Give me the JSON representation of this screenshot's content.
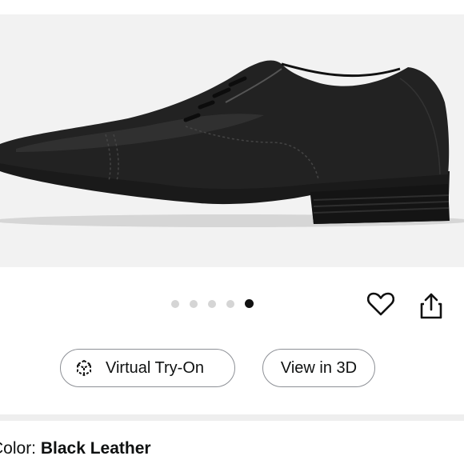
{
  "product_image": {
    "alt": "Black leather cap-toe oxford dress shoe",
    "carousel_count": 5,
    "active_index": 4
  },
  "actions": {
    "favorite_icon": "heart-outline-icon",
    "share_icon": "share-icon"
  },
  "buttons": {
    "virtual_try_on_label": "Virtual Try-On",
    "virtual_try_on_icon": "ar-cube-icon",
    "view_3d_label": "View in 3D"
  },
  "color": {
    "label": "Color: ",
    "value": "Black Leather"
  },
  "colors": {
    "dot_inactive": "#d5d5d5",
    "dot_active": "#111111",
    "border": "#8d9096"
  }
}
